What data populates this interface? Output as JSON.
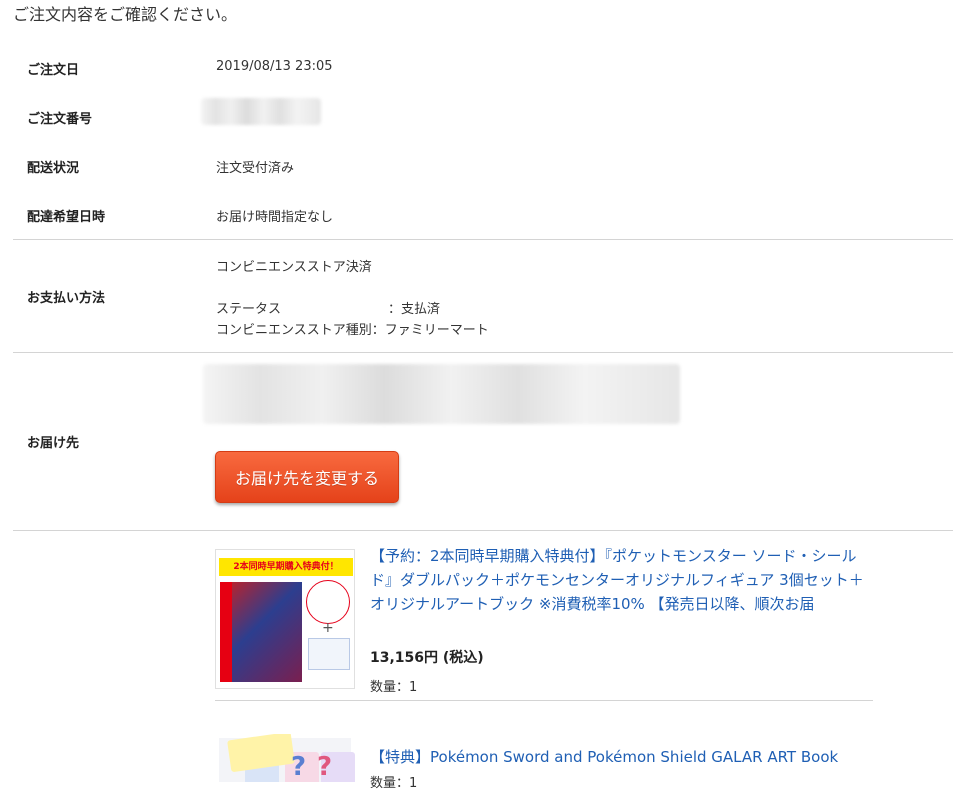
{
  "intro": "ご注文内容をご確認ください。",
  "order": {
    "date_label": "ご注文日",
    "date_value": "2019/08/13 23:05",
    "number_label": "ご注文番号",
    "shipping_status_label": "配送状況",
    "shipping_status_value": "注文受付済み",
    "delivery_time_label": "配達希望日時",
    "delivery_time_value": "お届け時間指定なし"
  },
  "payment": {
    "label": "お支払い方法",
    "method": "コンビニエンスストア決済",
    "status_key": "ステータス",
    "status_value": "：支払済",
    "store_key": "コンビニエンスストア種別",
    "store_value": "：ファミリーマート"
  },
  "shipping": {
    "label": "お届け先",
    "change_button": "お届け先を変更する"
  },
  "items": [
    {
      "title": "【予約：2本同時早期購入特典付】『ポケットモンスター ソード・シールド』ダブルパック＋ポケモンセンターオリジナルフィギュア 3個セット＋オリジナルアートブック ※消費税率10% 【発売日以降、順次お届",
      "price": "13,156円 (税込)",
      "quantity": "数量：1",
      "thumb_banner": "2本同時早期購入特典付！"
    },
    {
      "title": "【特典】Pokémon Sword and Pokémon Shield GALAR ART Book",
      "quantity": "数量：1"
    }
  ],
  "colors": {
    "button": "#e5421a",
    "link": "#1f5fb4",
    "divider": "#d4d4d4"
  }
}
